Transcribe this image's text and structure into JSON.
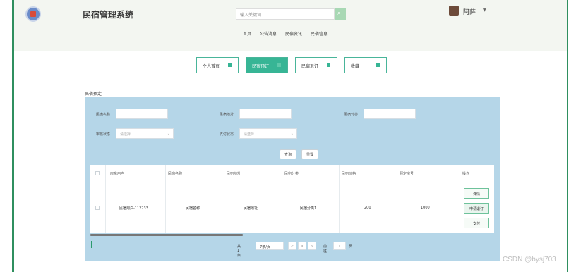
{
  "header": {
    "site_title": "民宿管理系统",
    "search_placeholder": "输入关键词",
    "user_name": "阿萨",
    "nav": [
      "首页",
      "公告消息",
      "民宿资讯",
      "民宿信息"
    ]
  },
  "tabs": [
    "个人首页",
    "民宿预订",
    "民宿退订",
    "收藏"
  ],
  "panel": {
    "title": "民宿预定",
    "filters": {
      "name_label": "民宿名称",
      "addr_label": "民宿地址",
      "type_label": "民宿分类",
      "review_label": "审核状态",
      "pay_label": "支付状态",
      "select_placeholder": "请选择"
    },
    "buttons": {
      "query": "查询",
      "reset": "重置"
    }
  },
  "table": {
    "headers": [
      "房东用户",
      "民宿名称",
      "民宿地址",
      "民宿分类",
      "民宿价格",
      "预定房号",
      "操作"
    ],
    "row": {
      "user": "民宿用户-112233",
      "name": "民宿名称",
      "address": "民宿地址",
      "type": "民宿分类1",
      "price": "200",
      "room": "1000"
    },
    "ops": [
      "详情",
      "申请退订",
      "支付"
    ]
  },
  "pager": {
    "total": "共 1 条",
    "page_size": "7条/页",
    "prev": "<",
    "current": "1",
    "next": ">",
    "goto": "前往",
    "goto_value": "1",
    "page_suffix": "页"
  },
  "watermark": "CSDN @bysj703"
}
